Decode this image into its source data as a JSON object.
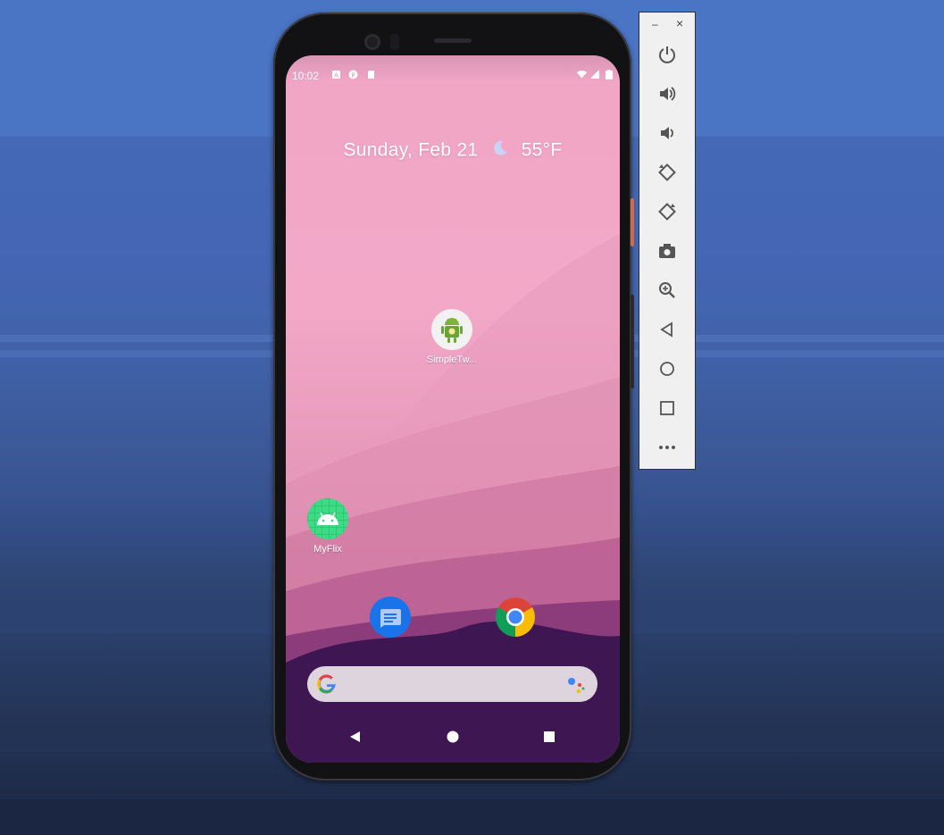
{
  "status_bar": {
    "time": "10:02"
  },
  "date_widget": {
    "date": "Sunday, Feb 21",
    "weather_icon": "moon-icon",
    "temperature": "55°F"
  },
  "home_apps": [
    {
      "label": "SimpleTw...",
      "icon": "android-robot-icon"
    },
    {
      "label": "MyFlix",
      "icon": "android-head-icon"
    }
  ],
  "dock": [
    {
      "name": "Messages",
      "icon": "messages-icon"
    },
    {
      "name": "Chrome",
      "icon": "chrome-icon"
    }
  ],
  "search_bar": {
    "icon_left": "google-g-icon",
    "icon_right": "google-assistant-icon"
  },
  "nav_bar": [
    "back-icon",
    "home-icon",
    "recents-icon"
  ],
  "emulator_panel": {
    "window_controls": {
      "minimize": "–",
      "close": "×"
    },
    "buttons": [
      "power",
      "volume-up",
      "volume-down",
      "rotate-left",
      "rotate-right",
      "screenshot",
      "zoom",
      "back",
      "home",
      "overview",
      "more"
    ]
  },
  "colors": {
    "desktop_bg": "#4a74c4",
    "panel_bg": "#f0f0f0",
    "screen_pink": "#f3a8c8",
    "screen_purple": "#2a0a3b"
  }
}
